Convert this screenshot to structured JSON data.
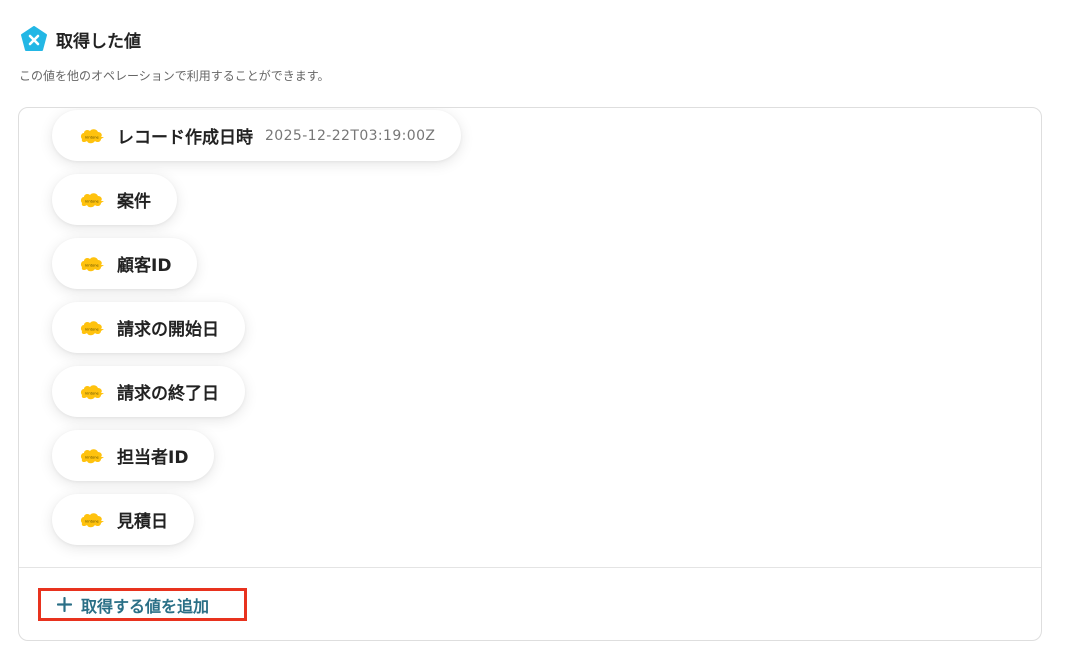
{
  "header": {
    "title": "取得した値",
    "logo_icon": "yoom-x-pentagon-icon",
    "accent_color": "#23b7e5"
  },
  "description": "この値を他のオペレーションで利用することができます。",
  "fields": [
    {
      "label": "レコード作成日時",
      "value": "2025-12-22T03:19:00Z",
      "icon": "kintone-icon"
    },
    {
      "label": "案件",
      "value": "",
      "icon": "kintone-icon"
    },
    {
      "label": "顧客ID",
      "value": "",
      "icon": "kintone-icon"
    },
    {
      "label": "請求の開始日",
      "value": "",
      "icon": "kintone-icon"
    },
    {
      "label": "請求の終了日",
      "value": "",
      "icon": "kintone-icon"
    },
    {
      "label": "担当者ID",
      "value": "",
      "icon": "kintone-icon"
    },
    {
      "label": "見積日",
      "value": "",
      "icon": "kintone-icon"
    }
  ],
  "add_button": {
    "label": "取得する値を追加",
    "icon": "plus-icon",
    "color": "#2a6f86",
    "highlight_color": "#e8321e"
  }
}
